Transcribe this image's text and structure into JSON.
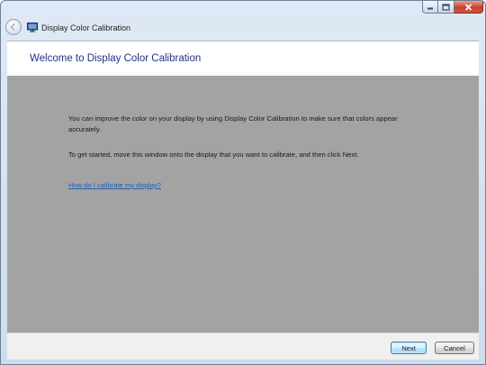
{
  "window": {
    "title": "Display Color Calibration"
  },
  "icons": {
    "back": "back-arrow-icon",
    "app": "display-icon",
    "minimize": "minimize-icon",
    "maximize": "maximize-icon",
    "close": "close-icon"
  },
  "header": {
    "title": "Welcome to Display Color Calibration"
  },
  "content": {
    "paragraph1": "You can improve the color on your display by using Display Color Calibration to make sure that colors appear accurately.",
    "paragraph2": "To get started, move this window onto the display that you want to calibrate, and then click Next.",
    "help_link": "How do I calibrate my display?"
  },
  "footer": {
    "next_label": "Next",
    "cancel_label": "Cancel"
  },
  "colors": {
    "content_background": "#a3a3a3",
    "header_title": "#1e3287",
    "link": "#1f5fb8"
  }
}
